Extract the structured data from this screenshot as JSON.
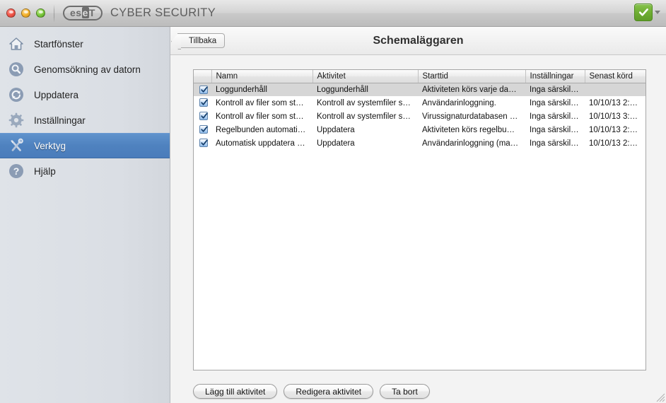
{
  "window": {
    "brand_name": "CYBER SECURITY",
    "logo_text_a": "es",
    "logo_text_b": "e",
    "logo_text_c": "T",
    "traffic_lights": [
      "close-button",
      "minimize-button",
      "zoom-button"
    ],
    "status_icon": "green-check-icon",
    "status_color": "#6fae33"
  },
  "sidebar": {
    "items": [
      {
        "label": "Startfönster",
        "icon": "home-icon",
        "selected": false
      },
      {
        "label": "Genomsökning av datorn",
        "icon": "magnifier-icon",
        "selected": false
      },
      {
        "label": "Uppdatera",
        "icon": "refresh-icon",
        "selected": false
      },
      {
        "label": "Inställningar",
        "icon": "gear-icon",
        "selected": false
      },
      {
        "label": "Verktyg",
        "icon": "tools-icon",
        "selected": true
      },
      {
        "label": "Hjälp",
        "icon": "question-icon",
        "selected": false
      }
    ],
    "selected_color": "#4f82bf"
  },
  "header": {
    "back_label": "Tillbaka",
    "title": "Schemaläggaren"
  },
  "table": {
    "columns": [
      "",
      "Namn",
      "Aktivitet",
      "Starttid",
      "Inställningar",
      "Senast körd"
    ],
    "rows": [
      {
        "checked": true,
        "selected": true,
        "name": "Loggunderhåll",
        "activity": "Loggunderhåll",
        "start": "Aktiviteten körs varje da…",
        "settings": "Inga särskil…",
        "last_run": ""
      },
      {
        "checked": true,
        "selected": false,
        "name": "Kontroll av filer som st…",
        "activity": "Kontroll av systemfiler s…",
        "start": "Användarinloggning.",
        "settings": "Inga särskil…",
        "last_run": "10/10/13 2:…"
      },
      {
        "checked": true,
        "selected": false,
        "name": "Kontroll av filer som st…",
        "activity": "Kontroll av systemfiler s…",
        "start": "Virussignaturdatabasen …",
        "settings": "Inga särskil…",
        "last_run": "10/10/13 3:…"
      },
      {
        "checked": true,
        "selected": false,
        "name": "Regelbunden automati…",
        "activity": "Uppdatera",
        "start": "Aktiviteten körs regelbu…",
        "settings": "Inga särskil…",
        "last_run": "10/10/13 2:…"
      },
      {
        "checked": true,
        "selected": false,
        "name": "Automatisk uppdatera …",
        "activity": "Uppdatera",
        "start": "Användarinloggning (ma…",
        "settings": "Inga särskil…",
        "last_run": "10/10/13 2:…"
      }
    ]
  },
  "footer": {
    "buttons": [
      {
        "label": "Lägg till aktivitet",
        "name": "add-task-button"
      },
      {
        "label": "Redigera aktivitet",
        "name": "edit-task-button"
      },
      {
        "label": "Ta bort",
        "name": "delete-task-button"
      }
    ]
  }
}
